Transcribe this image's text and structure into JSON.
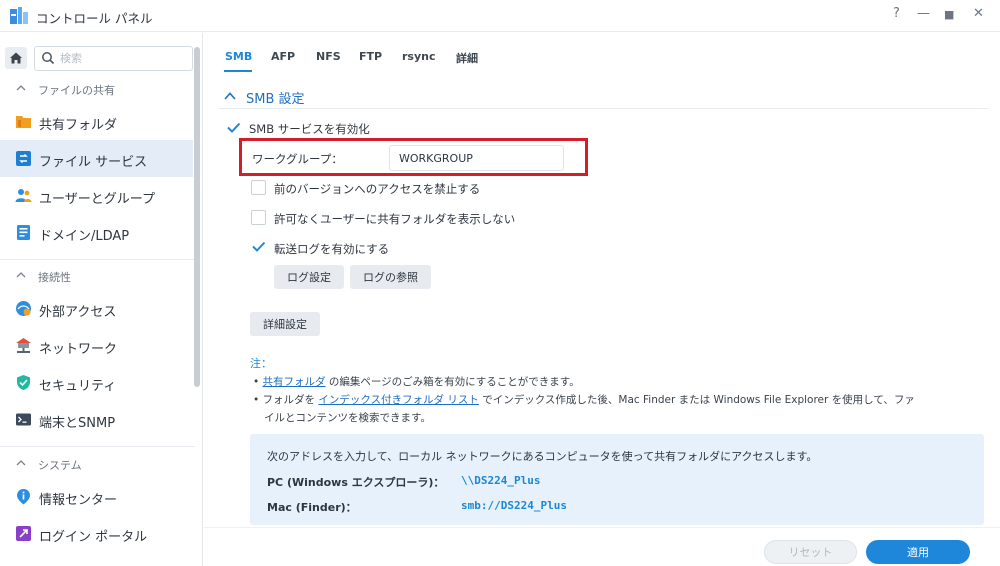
{
  "window": {
    "title": "コントロール パネル",
    "controls": [
      "?",
      "—",
      "■",
      "✕"
    ]
  },
  "sidebar": {
    "search_placeholder": "検索",
    "sections": [
      {
        "label": "ファイルの共有",
        "items": [
          "共有フォルダ",
          "ファイル サービス",
          "ユーザーとグループ",
          "ドメイン/LDAP"
        ]
      },
      {
        "label": "接続性",
        "items": [
          "外部アクセス",
          "ネットワーク",
          "セキュリティ",
          "端末とSNMP"
        ]
      },
      {
        "label": "システム",
        "items": [
          "情報センター",
          "ログイン ポータル"
        ]
      }
    ],
    "active_item": "ファイル サービス"
  },
  "tabs": [
    "SMB",
    "AFP",
    "NFS",
    "FTP",
    "rsync",
    "詳細"
  ],
  "active_tab": "SMB",
  "panel": {
    "title": "SMB 設定",
    "enable_smb": {
      "label": "SMB サービスを有効化",
      "checked": true
    },
    "workgroup": {
      "label": "ワークグループ：",
      "value": "WORKGROUP"
    },
    "options": [
      {
        "label": "前のバージョンへのアクセスを禁止する",
        "checked": false
      },
      {
        "label": "許可なくユーザーに共有フォルダを表示しない",
        "checked": false
      },
      {
        "label": "転送ログを有効にする",
        "checked": true
      }
    ],
    "log_settings_button": "ログ設定",
    "log_view_button": "ログの参照",
    "advanced_button": "詳細設定",
    "note": {
      "title": "注：",
      "line1_link": "共有フォルダ",
      "line1_text": " の編集ページのごみ箱を有効にすることができます。",
      "line2_pre": "フォルダを ",
      "line2_link": "インデックス付きフォルダ リスト",
      "line2_text": " でインデックス作成した後、Mac Finder または Windows File Explorer を使用して、ファ",
      "line3_text": "イルとコンテンツを検索できます。"
    },
    "info": {
      "text": "次のアドレスを入力して、ローカル ネットワークにあるコンピュータを使って共有フォルダにアクセスします。",
      "pc_label": "PC (Windows エクスプローラ)：",
      "pc_value": "\\\\DS224_Plus",
      "mac_label": "Mac (Finder)：",
      "mac_value": "smb://DS224_Plus"
    }
  },
  "footer": {
    "reset_label": "リセット",
    "apply_label": "適用"
  },
  "colors": {
    "accent": "#1d87d6",
    "highlight_border": "#d11e2a",
    "active_nav_bg": "#e4ecf8",
    "info_bg": "#e6f1fb"
  }
}
